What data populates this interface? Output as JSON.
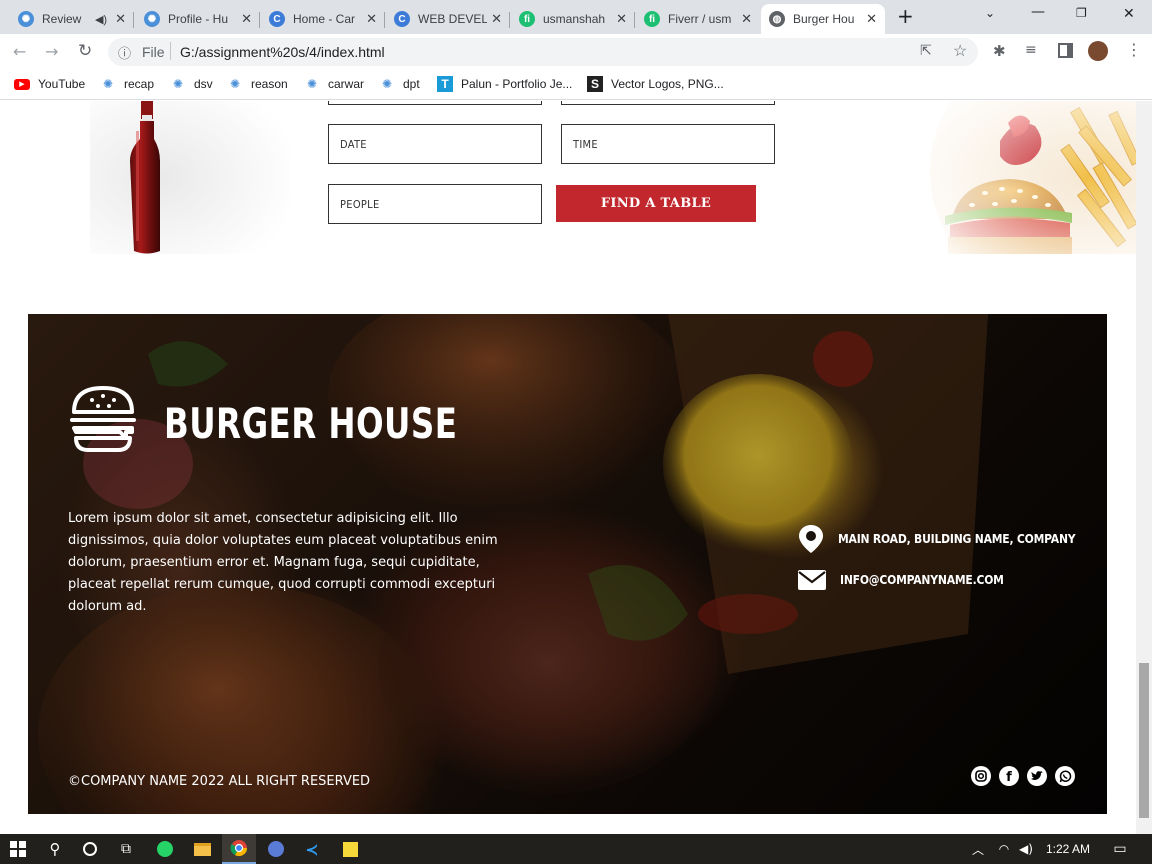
{
  "browser": {
    "tabs": [
      {
        "title": "Review",
        "favicon": "brain-icon",
        "audio": true
      },
      {
        "title": "Profile - Hu",
        "favicon": "brain-icon"
      },
      {
        "title": "Home - Car",
        "favicon": "canva-icon"
      },
      {
        "title": "WEB DEVEL",
        "favicon": "canva-icon"
      },
      {
        "title": "usmanshah",
        "favicon": "fiverr-icon"
      },
      {
        "title": "Fiverr / usm",
        "favicon": "fiverr-icon"
      },
      {
        "title": "Burger Hou",
        "favicon": "globe-icon",
        "active": true
      }
    ],
    "address": {
      "scheme_label": "File",
      "url": "G:/assignment%20s/4/index.html"
    },
    "bookmarks": [
      {
        "label": "YouTube",
        "icon": "youtube-icon"
      },
      {
        "label": "recap",
        "icon": "brain-icon"
      },
      {
        "label": "dsv",
        "icon": "brain-icon"
      },
      {
        "label": "reason",
        "icon": "brain-icon"
      },
      {
        "label": "carwar",
        "icon": "brain-icon"
      },
      {
        "label": "dpt",
        "icon": "brain-icon"
      },
      {
        "label": "Palun - Portfolio Je...",
        "icon": "t-logo-icon"
      },
      {
        "label": "Vector Logos, PNG...",
        "icon": "s-logo-icon"
      }
    ]
  },
  "reservation": {
    "date_placeholder": "DATE",
    "time_placeholder": "TIME",
    "people_placeholder": "PEOPLE",
    "submit_label": "FIND A TABLE"
  },
  "footer": {
    "brand": "BURGER HOUSE",
    "description": "Lorem ipsum dolor sit amet, consectetur adipisicing elit. Illo dignissimos, quia dolor voluptates eum placeat voluptatibus enim dolorum, praesentium error et. Magnam fuga, sequi cupiditate, placeat repellat rerum cumque, quod corrupti commodi excepturi dolorum ad.",
    "address": "MAIN ROAD, BUILDING NAME, COMPANY",
    "email": "INFO@COMPANYNAME.COM",
    "copyright": "©COMPANY NAME 2022 ALL RIGHT RESERVED",
    "social": [
      "instagram-icon",
      "facebook-icon",
      "twitter-icon",
      "whatsapp-icon"
    ]
  },
  "taskbar": {
    "time": "1:22 AM"
  },
  "colors": {
    "accent": "#c1272d",
    "taskbar": "#22201d",
    "tabstrip": "#dee1e6"
  }
}
